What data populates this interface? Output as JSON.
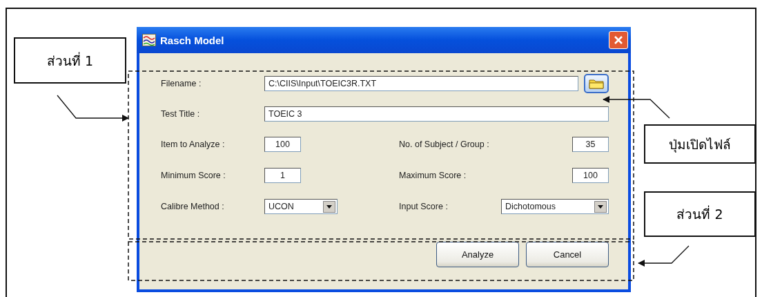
{
  "dialog": {
    "title": "Rasch Model",
    "filename": {
      "label": "Filename :",
      "value": "C:\\CIIS\\Input\\TOEIC3R.TXT"
    },
    "test_title": {
      "label": "Test Title :",
      "value": "TOEIC 3"
    },
    "options": [
      {
        "kind": "number",
        "label": "Item to Analyze :",
        "value": "100"
      },
      {
        "kind": "number",
        "label": "No. of Subject / Group :",
        "value": "35"
      },
      {
        "kind": "number",
        "label": "Minimum Score :",
        "value": "1"
      },
      {
        "kind": "number",
        "label": "Maximum Score :",
        "value": "100"
      },
      {
        "kind": "dropdown",
        "label": "Calibre Method :",
        "value": "UCON"
      },
      {
        "kind": "dropdown",
        "label": "Input Score :",
        "value": "Dichotomous"
      }
    ],
    "buttons": [
      "Analyze",
      "Cancel"
    ]
  },
  "callouts": [
    {
      "text": "ส่วนที่ 1"
    },
    {
      "text": "ปุ่มเปิดไฟล์"
    },
    {
      "text": "ส่วนที่ 2"
    }
  ]
}
